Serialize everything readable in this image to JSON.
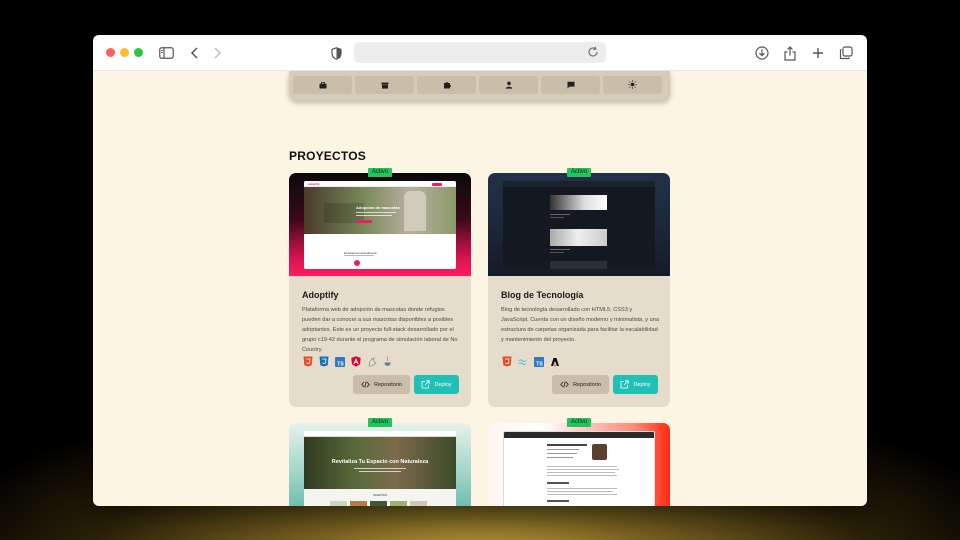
{
  "browser": {
    "toolbar_icons": [
      "sidebar-icon",
      "back-icon",
      "forward-icon",
      "shield-icon",
      "reload-icon",
      "download-icon",
      "share-icon",
      "new-tab-icon",
      "tabs-icon"
    ]
  },
  "nav": {
    "items": [
      {
        "icon": "briefcase-icon"
      },
      {
        "icon": "archive-icon"
      },
      {
        "icon": "puzzle-icon"
      },
      {
        "icon": "user-icon"
      },
      {
        "icon": "message-icon"
      },
      {
        "icon": "sun-icon"
      }
    ]
  },
  "section": {
    "title": "PROYECTOS"
  },
  "projects": [
    {
      "badge": "Activo",
      "title": "Adoptify",
      "description": "Plataforma web de adopción de mascotas donde refugios pueden dar a conocer a sus mascotas disponibles a posibles adoptantes. Este es un proyecto full-stack desarrollado por el grupo c19-42 durante el programa de simulación laboral de No Country.",
      "techs": [
        "html5-icon",
        "css3-icon",
        "typescript-icon",
        "angular-icon",
        "nestjs-icon",
        "java-icon"
      ],
      "repo_label": "Repositorio",
      "deploy_label": "Deploy",
      "screenshot": {
        "nav_brand": "adoptify",
        "hero_title": "Adopción de mascotas",
        "section_label": "El adopción actualmente"
      }
    },
    {
      "badge": "Activo",
      "title": "Blog de Tecnología",
      "description": "Blog de tecnología desarrollado con HTML5, CSS3 y JavaScript. Cuenta con un diseño moderno y minimalista, y una estructura de carpetas organizada para facilitar la escalabilidad y mantenimiento del proyecto.",
      "techs": [
        "html5-icon",
        "tailwind-icon",
        "typescript-icon",
        "astro-icon"
      ],
      "repo_label": "Repositorio",
      "deploy_label": "Deploy",
      "screenshot": {}
    },
    {
      "badge": "Activo",
      "screenshot": {
        "hero_title": "Revitaliza Tu Espacio con Naturaleza",
        "section_label": "OFERTAS"
      }
    },
    {
      "badge": "Activo",
      "screenshot": {}
    }
  ],
  "colors": {
    "page_bg": "#fdf5e4",
    "card_bg": "#e5dccb",
    "badge": "#21c45d",
    "deploy": "#1fc1b6",
    "repo": "#c9bea9"
  }
}
